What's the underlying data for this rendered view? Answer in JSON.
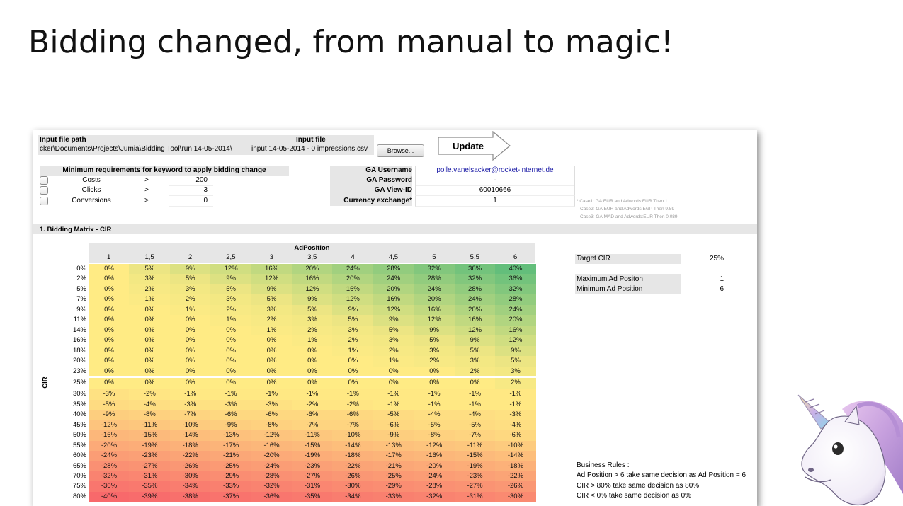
{
  "slide": {
    "title": "Bidding changed, from manual to magic!"
  },
  "header": {
    "input_path_label": "Input file path",
    "input_path_value": "cker\\Documents\\Projects\\Jumia\\Bidding Tool\\run 14-05-2014\\",
    "input_file_label": "Input file",
    "input_file_value": "input 14-05-2014 - 0 impressions.csv",
    "browse_label": "Browse...",
    "update_label": "Update"
  },
  "min_requirements": {
    "title": "Minimum requirements for keyword to apply bidding change",
    "rows": [
      {
        "label": "Costs",
        "op": ">",
        "value": "200"
      },
      {
        "label": "Clicks",
        "op": ">",
        "value": "3"
      },
      {
        "label": "Conversions",
        "op": ">",
        "value": "0"
      }
    ]
  },
  "ga": {
    "username_label": "GA Username",
    "username_value": "polle.vanelsacker@rocket-internet.de",
    "password_label": "GA Password",
    "password_value": "-",
    "viewid_label": "GA View-ID",
    "viewid_value": "60010666",
    "currency_label": "Currency exchange*",
    "currency_value": "1"
  },
  "notes": [
    "* Case1: GA:EUR and Adwords:EUR Then 1",
    "Case2: GA:EUR and Adwords:EGP Then 9.59",
    "Case3: GA:MAD and Adwords:EUR Then 0.089"
  ],
  "section": {
    "title": "1. Bidding Matrix - CIR"
  },
  "matrix": {
    "x_title": "AdPosition",
    "y_title": "CIR",
    "columns": [
      "1",
      "1,5",
      "2",
      "2,5",
      "3",
      "3,5",
      "4",
      "4,5",
      "5",
      "5,5",
      "6"
    ],
    "rows": [
      {
        "label": "0%",
        "values": [
          "0%",
          "5%",
          "9%",
          "12%",
          "16%",
          "20%",
          "24%",
          "28%",
          "32%",
          "36%",
          "40%"
        ]
      },
      {
        "label": "2%",
        "values": [
          "0%",
          "3%",
          "5%",
          "9%",
          "12%",
          "16%",
          "20%",
          "24%",
          "28%",
          "32%",
          "36%"
        ]
      },
      {
        "label": "5%",
        "values": [
          "0%",
          "2%",
          "3%",
          "5%",
          "9%",
          "12%",
          "16%",
          "20%",
          "24%",
          "28%",
          "32%"
        ]
      },
      {
        "label": "7%",
        "values": [
          "0%",
          "1%",
          "2%",
          "3%",
          "5%",
          "9%",
          "12%",
          "16%",
          "20%",
          "24%",
          "28%"
        ]
      },
      {
        "label": "9%",
        "values": [
          "0%",
          "0%",
          "1%",
          "2%",
          "3%",
          "5%",
          "9%",
          "12%",
          "16%",
          "20%",
          "24%"
        ]
      },
      {
        "label": "11%",
        "values": [
          "0%",
          "0%",
          "0%",
          "1%",
          "2%",
          "3%",
          "5%",
          "9%",
          "12%",
          "16%",
          "20%"
        ]
      },
      {
        "label": "14%",
        "values": [
          "0%",
          "0%",
          "0%",
          "0%",
          "1%",
          "2%",
          "3%",
          "5%",
          "9%",
          "12%",
          "16%"
        ]
      },
      {
        "label": "16%",
        "values": [
          "0%",
          "0%",
          "0%",
          "0%",
          "0%",
          "1%",
          "2%",
          "3%",
          "5%",
          "9%",
          "12%"
        ]
      },
      {
        "label": "18%",
        "values": [
          "0%",
          "0%",
          "0%",
          "0%",
          "0%",
          "0%",
          "1%",
          "2%",
          "3%",
          "5%",
          "9%"
        ]
      },
      {
        "label": "20%",
        "values": [
          "0%",
          "0%",
          "0%",
          "0%",
          "0%",
          "0%",
          "0%",
          "1%",
          "2%",
          "3%",
          "5%"
        ]
      },
      {
        "label": "23%",
        "values": [
          "0%",
          "0%",
          "0%",
          "0%",
          "0%",
          "0%",
          "0%",
          "0%",
          "0%",
          "2%",
          "3%"
        ]
      },
      {
        "label": "25%",
        "values": [
          "0%",
          "0%",
          "0%",
          "0%",
          "0%",
          "0%",
          "0%",
          "0%",
          "0%",
          "0%",
          "2%"
        ]
      },
      {
        "label": "30%",
        "values": [
          "-3%",
          "-2%",
          "-1%",
          "-1%",
          "-1%",
          "-1%",
          "-1%",
          "-1%",
          "-1%",
          "-1%",
          "-1%"
        ]
      },
      {
        "label": "35%",
        "values": [
          "-5%",
          "-4%",
          "-3%",
          "-3%",
          "-3%",
          "-2%",
          "-2%",
          "-1%",
          "-1%",
          "-1%",
          "-1%"
        ]
      },
      {
        "label": "40%",
        "values": [
          "-9%",
          "-8%",
          "-7%",
          "-6%",
          "-6%",
          "-6%",
          "-6%",
          "-5%",
          "-4%",
          "-4%",
          "-3%"
        ]
      },
      {
        "label": "45%",
        "values": [
          "-12%",
          "-11%",
          "-10%",
          "-9%",
          "-8%",
          "-7%",
          "-7%",
          "-6%",
          "-5%",
          "-5%",
          "-4%"
        ]
      },
      {
        "label": "50%",
        "values": [
          "-16%",
          "-15%",
          "-14%",
          "-13%",
          "-12%",
          "-11%",
          "-10%",
          "-9%",
          "-8%",
          "-7%",
          "-6%"
        ]
      },
      {
        "label": "55%",
        "values": [
          "-20%",
          "-19%",
          "-18%",
          "-17%",
          "-16%",
          "-15%",
          "-14%",
          "-13%",
          "-12%",
          "-11%",
          "-10%"
        ]
      },
      {
        "label": "60%",
        "values": [
          "-24%",
          "-23%",
          "-22%",
          "-21%",
          "-20%",
          "-19%",
          "-18%",
          "-17%",
          "-16%",
          "-15%",
          "-14%"
        ]
      },
      {
        "label": "65%",
        "values": [
          "-28%",
          "-27%",
          "-26%",
          "-25%",
          "-24%",
          "-23%",
          "-22%",
          "-21%",
          "-20%",
          "-19%",
          "-18%"
        ]
      },
      {
        "label": "70%",
        "values": [
          "-32%",
          "-31%",
          "-30%",
          "-29%",
          "-28%",
          "-27%",
          "-26%",
          "-25%",
          "-24%",
          "-23%",
          "-22%"
        ]
      },
      {
        "label": "75%",
        "values": [
          "-36%",
          "-35%",
          "-34%",
          "-33%",
          "-32%",
          "-31%",
          "-30%",
          "-29%",
          "-28%",
          "-27%",
          "-26%"
        ]
      },
      {
        "label": "80%",
        "values": [
          "-40%",
          "-39%",
          "-38%",
          "-37%",
          "-36%",
          "-35%",
          "-34%",
          "-33%",
          "-32%",
          "-31%",
          "-30%"
        ]
      }
    ],
    "highlight_row_label": "25%",
    "colors": {
      "max_positive": "#63be7b",
      "neutral": "#ffeb84",
      "max_negative": "#f8696b"
    }
  },
  "settings": {
    "target_cir_label": "Target CIR",
    "target_cir_value": "25%",
    "max_ad_label": "Maximum Ad Positon",
    "max_ad_value": "1",
    "min_ad_label": "Minimum Ad Position",
    "min_ad_value": "6"
  },
  "business_rules": {
    "title": "Business Rules :",
    "items": [
      "Ad Position > 6 take same decision as Ad Position = 6",
      "CIR > 80% take same decision as 80%",
      "CIR < 0% take same decision as 0%"
    ]
  },
  "decoration": {
    "unicorn_icon": "unicorn-icon"
  }
}
